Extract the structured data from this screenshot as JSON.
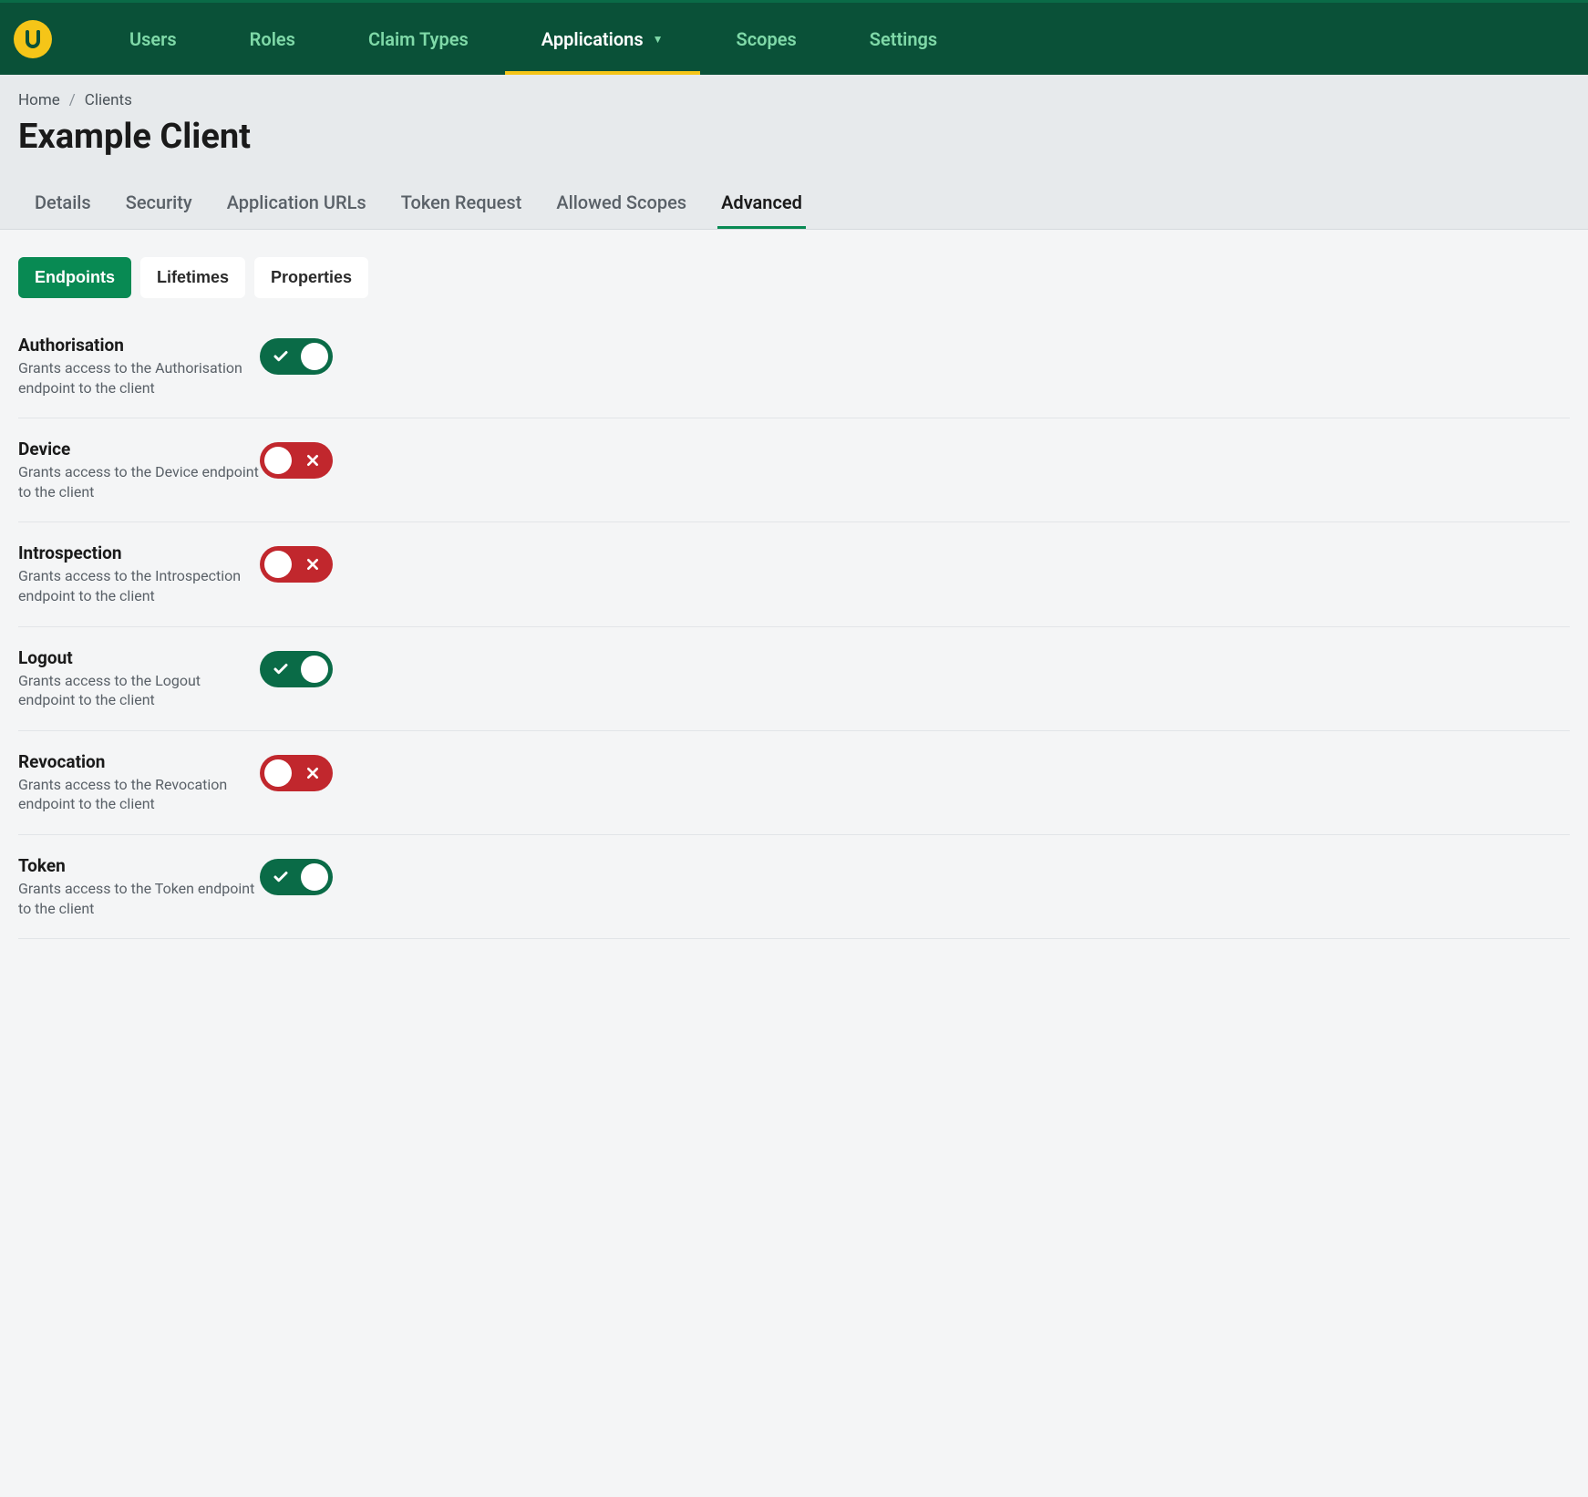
{
  "nav": {
    "items": [
      {
        "label": "Users",
        "active": false,
        "hasDropdown": false
      },
      {
        "label": "Roles",
        "active": false,
        "hasDropdown": false
      },
      {
        "label": "Claim Types",
        "active": false,
        "hasDropdown": false
      },
      {
        "label": "Applications",
        "active": true,
        "hasDropdown": true
      },
      {
        "label": "Scopes",
        "active": false,
        "hasDropdown": false
      },
      {
        "label": "Settings",
        "active": false,
        "hasDropdown": false
      }
    ]
  },
  "breadcrumb": {
    "home": "Home",
    "clients": "Clients"
  },
  "page": {
    "title": "Example Client"
  },
  "tabs": [
    {
      "label": "Details",
      "active": false
    },
    {
      "label": "Security",
      "active": false
    },
    {
      "label": "Application URLs",
      "active": false
    },
    {
      "label": "Token Request",
      "active": false
    },
    {
      "label": "Allowed Scopes",
      "active": false
    },
    {
      "label": "Advanced",
      "active": true
    }
  ],
  "pills": [
    {
      "label": "Endpoints",
      "active": true
    },
    {
      "label": "Lifetimes",
      "active": false
    },
    {
      "label": "Properties",
      "active": false
    }
  ],
  "settings": [
    {
      "label": "Authorisation",
      "desc": "Grants access to the Authorisation endpoint to the client",
      "on": true
    },
    {
      "label": "Device",
      "desc": "Grants access to the Device endpoint to the client",
      "on": false
    },
    {
      "label": "Introspection",
      "desc": "Grants access to the Introspection endpoint to the client",
      "on": false
    },
    {
      "label": "Logout",
      "desc": "Grants access to the Logout endpoint to the client",
      "on": true
    },
    {
      "label": "Revocation",
      "desc": "Grants access to the Revocation endpoint to the client",
      "on": false
    },
    {
      "label": "Token",
      "desc": "Grants access to the Token endpoint to the client",
      "on": true
    }
  ]
}
